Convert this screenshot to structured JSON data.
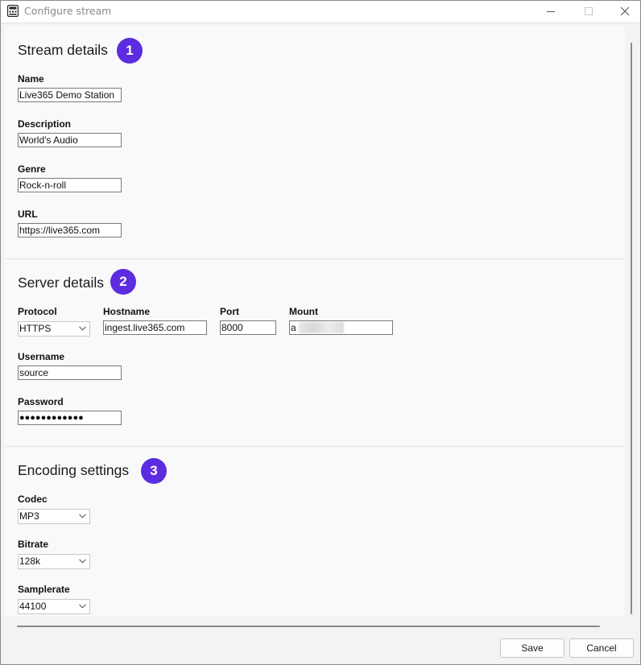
{
  "window": {
    "title": "Configure stream"
  },
  "stream": {
    "title": "Stream details",
    "badge": "1",
    "name_label": "Name",
    "name_value": "Live365 Demo Station",
    "description_label": "Description",
    "description_value": "World's Audio",
    "genre_label": "Genre",
    "genre_value": "Rock-n-roll",
    "url_label": "URL",
    "url_value": "https://live365.com"
  },
  "server": {
    "title": "Server details",
    "badge": "2",
    "protocol_label": "Protocol",
    "protocol_value": "HTTPS",
    "hostname_label": "Hostname",
    "hostname_value": "ingest.live365.com",
    "port_label": "Port",
    "port_value": "8000",
    "mount_label": "Mount",
    "mount_value": "a",
    "username_label": "Username",
    "username_value": "source",
    "password_label": "Password",
    "password_value": "●●●●●●●●●●●●"
  },
  "encoding": {
    "title": "Encoding settings",
    "badge": "3",
    "codec_label": "Codec",
    "codec_value": "MP3",
    "bitrate_label": "Bitrate",
    "bitrate_value": "128k",
    "samplerate_label": "Samplerate",
    "samplerate_value": "44100"
  },
  "footer": {
    "save_label": "Save",
    "cancel_label": "Cancel"
  },
  "colors": {
    "badge": "#5b2ce0",
    "content_bg": "#f9f9fb",
    "window_bg": "#f3f3f3"
  },
  "icons": {
    "app": "app-window-icon",
    "minimize": "minimize-icon",
    "maximize": "maximize-icon",
    "close": "close-icon",
    "dropdown": "chevron-down-icon"
  }
}
